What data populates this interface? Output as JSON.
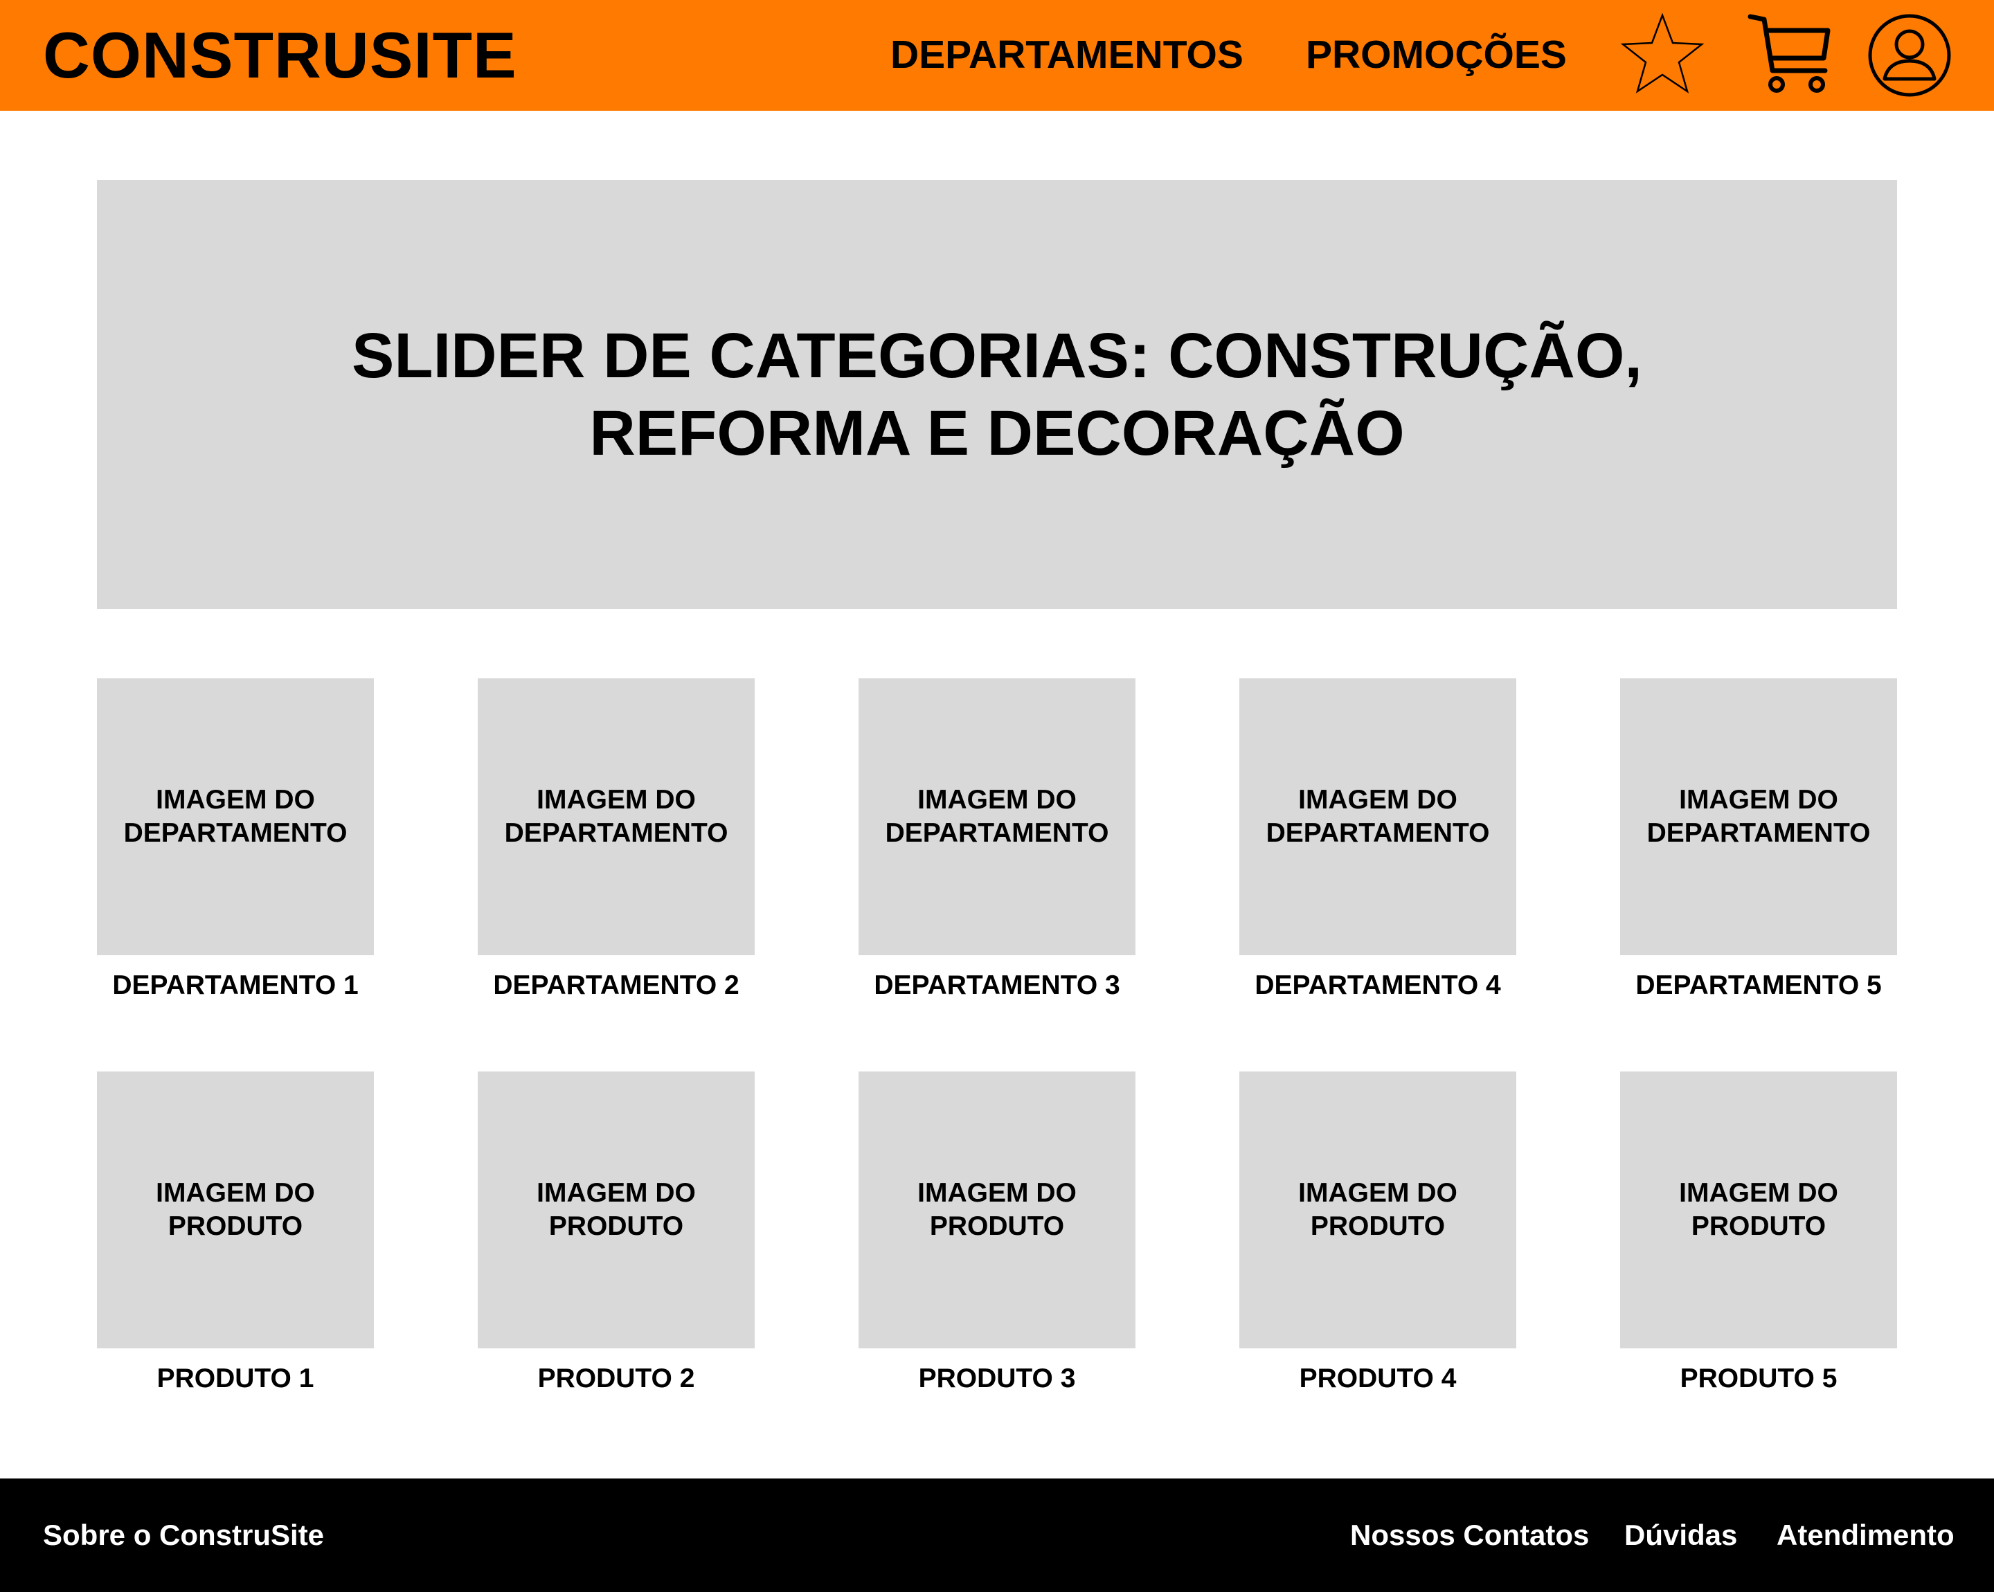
{
  "header": {
    "logo": "CONSTRUSITE",
    "nav": [
      {
        "label": "DEPARTAMENTOS"
      },
      {
        "label": "PROMOÇÕES"
      }
    ],
    "icons": [
      "star-icon",
      "cart-icon",
      "user-icon"
    ],
    "background_color": "#ff7a00"
  },
  "hero": {
    "text": "SLIDER DE CATEGORIAS: CONSTRUÇÃO, REFORMA E DECORAÇÃO"
  },
  "departments": [
    {
      "image_label": "IMAGEM DO DEPARTAMENTO",
      "label": "DEPARTAMENTO 1"
    },
    {
      "image_label": "IMAGEM DO DEPARTAMENTO",
      "label": "DEPARTAMENTO 2"
    },
    {
      "image_label": "IMAGEM DO DEPARTAMENTO",
      "label": "DEPARTAMENTO 3"
    },
    {
      "image_label": "IMAGEM DO DEPARTAMENTO",
      "label": "DEPARTAMENTO 4"
    },
    {
      "image_label": "IMAGEM DO DEPARTAMENTO",
      "label": "DEPARTAMENTO 5"
    }
  ],
  "products": [
    {
      "image_label": "IMAGEM DO PRODUTO",
      "label": "PRODUTO 1"
    },
    {
      "image_label": "IMAGEM DO PRODUTO",
      "label": "PRODUTO 2"
    },
    {
      "image_label": "IMAGEM DO PRODUTO",
      "label": "PRODUTO 3"
    },
    {
      "image_label": "IMAGEM DO PRODUTO",
      "label": "PRODUTO 4"
    },
    {
      "image_label": "IMAGEM DO PRODUTO",
      "label": "PRODUTO 5"
    }
  ],
  "footer": {
    "about": "Sobre o ConstruSite",
    "links": [
      {
        "label": "Nossos Contatos"
      },
      {
        "label": "Dúvidas"
      },
      {
        "label": "Atendimento"
      }
    ]
  }
}
